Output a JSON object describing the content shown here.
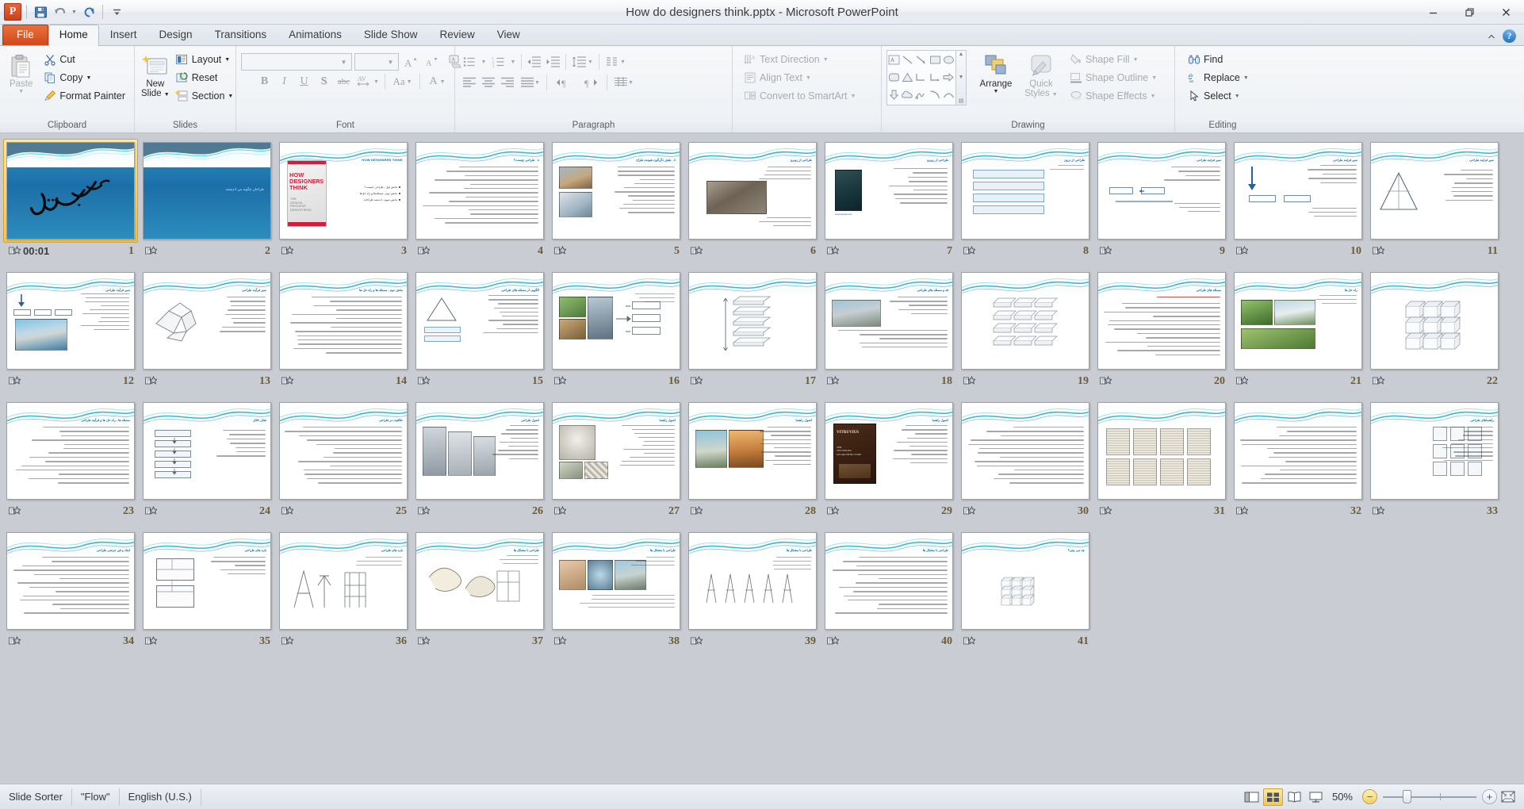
{
  "window": {
    "title": "How do designers think.pptx  -  Microsoft PowerPoint",
    "app_logo": "P",
    "minimize": "—",
    "restore": "❐",
    "close": "✕"
  },
  "quick_access": [
    {
      "name": "save",
      "glyph": "💾"
    },
    {
      "name": "undo",
      "glyph": "↶"
    },
    {
      "name": "undo-dropdown",
      "glyph": "▾"
    },
    {
      "name": "redo",
      "glyph": "↻"
    },
    {
      "name": "customize-qat",
      "glyph": "▾"
    }
  ],
  "tabs": [
    {
      "label": "File",
      "kind": "file"
    },
    {
      "label": "Home",
      "kind": "active"
    },
    {
      "label": "Insert",
      "kind": "normal"
    },
    {
      "label": "Design",
      "kind": "normal"
    },
    {
      "label": "Transitions",
      "kind": "normal"
    },
    {
      "label": "Animations",
      "kind": "normal"
    },
    {
      "label": "Slide Show",
      "kind": "normal"
    },
    {
      "label": "Review",
      "kind": "normal"
    },
    {
      "label": "View",
      "kind": "normal"
    }
  ],
  "tabrow_right": {
    "minimize_ribbon": "⌃",
    "help": "?"
  },
  "ribbon": {
    "groups": [
      {
        "name": "clipboard",
        "label": "Clipboard",
        "has_launcher": true
      },
      {
        "name": "slides",
        "label": "Slides",
        "has_launcher": false
      },
      {
        "name": "font",
        "label": "Font",
        "has_launcher": true
      },
      {
        "name": "paragraph",
        "label": "Paragraph",
        "has_launcher": true
      },
      {
        "name": "drawing",
        "label": "Drawing",
        "has_launcher": true
      },
      {
        "name": "editing",
        "label": "Editing",
        "has_launcher": false
      }
    ],
    "clipboard": {
      "paste": "Paste",
      "cut": "Cut",
      "copy": "Copy",
      "format_painter": "Format Painter"
    },
    "slides": {
      "new_slide": "New\nSlide",
      "new_slide_line1": "New",
      "new_slide_line2": "Slide",
      "layout": "Layout",
      "reset": "Reset",
      "section": "Section"
    },
    "font": {
      "font_name_value": "",
      "font_size_value": "",
      "grow_font": "A",
      "shrink_font": "A",
      "clear_formatting": "Aa",
      "bold": "B",
      "italic": "I",
      "underline": "U",
      "shadow": "S",
      "strikethrough": "abc",
      "character_spacing": "AV",
      "change_case": "Aa",
      "font_color": "A"
    },
    "paragraph": {
      "text_direction": "Text Direction",
      "align_text": "Align Text",
      "convert_to_smartart": "Convert to SmartArt"
    },
    "drawing": {
      "arrange": "Arrange",
      "quick_styles_line1": "Quick",
      "quick_styles_line2": "Styles",
      "shape_fill": "Shape Fill",
      "shape_outline": "Shape Outline",
      "shape_effects": "Shape Effects"
    },
    "editing": {
      "find": "Find",
      "replace": "Replace",
      "select": "Select"
    }
  },
  "status_bar": {
    "view_name": "Slide Sorter",
    "theme_name": "\"Flow\"",
    "language": "English (U.S.)",
    "zoom_level": "50%",
    "zoom_out": "−",
    "zoom_in": "+",
    "views": [
      {
        "name": "normal-view",
        "active": false
      },
      {
        "name": "slide-sorter-view",
        "active": true
      },
      {
        "name": "reading-view",
        "active": false
      },
      {
        "name": "slide-show-view",
        "active": false
      }
    ],
    "fit_to_window": "fit-slide-to-window"
  },
  "slides": {
    "selected_index": 1,
    "timing_label": "00:01",
    "items": [
      {
        "n": "1",
        "style": "dark-bismillah",
        "timing": "00:01",
        "selected": true
      },
      {
        "n": "2",
        "style": "dark-title",
        "title": "طراحان چگونه می اندیشند"
      },
      {
        "n": "3",
        "style": "book-cover",
        "title": "HOW DESIGNERS THINK"
      },
      {
        "n": "4",
        "style": "text-only",
        "title": "1 . طراحی چیست؟"
      },
      {
        "n": "5",
        "style": "two-images-left",
        "title": "2 . نقش دگرگون شونده طراح"
      },
      {
        "n": "6",
        "style": "one-image-center",
        "title": "طراحی از روبرو"
      },
      {
        "n": "7",
        "style": "image-left-narrow",
        "title": "طراحی از روبرو"
      },
      {
        "n": "8",
        "style": "stack-boxes",
        "title": "طراحی از درون"
      },
      {
        "n": "9",
        "style": "diagram-arrows",
        "title": "سیر فرایند طراحی"
      },
      {
        "n": "10",
        "style": "diagram-arrow-down",
        "title": "سیر فرایند طراحی"
      },
      {
        "n": "11",
        "style": "triangle-diagram",
        "title": "سیر فرایند طراحی"
      },
      {
        "n": "12",
        "style": "opera-house",
        "title": "سیر فرآیند طراحی"
      },
      {
        "n": "13",
        "style": "folded-paper",
        "title": "سیر فرآیند طراحی"
      },
      {
        "n": "14",
        "style": "text-only",
        "title": "بخش دوم - مسئله ها و راه حل ها"
      },
      {
        "n": "15",
        "style": "diagram-chart",
        "title": "الگویی از مسئله های طراحی"
      },
      {
        "n": "16",
        "style": "collage-flow",
        "title": ""
      },
      {
        "n": "17",
        "style": "stack-tall",
        "title": ""
      },
      {
        "n": "18",
        "style": "photo-right",
        "title": "قد و مسئله های طراحی"
      },
      {
        "n": "19",
        "style": "stack-boxes3",
        "title": ""
      },
      {
        "n": "20",
        "style": "text-red",
        "title": "مسئله های طراحی"
      },
      {
        "n": "21",
        "style": "lotus-temple",
        "title": "راه حل ها"
      },
      {
        "n": "22",
        "style": "cube-grid",
        "title": ""
      },
      {
        "n": "23",
        "style": "text-only",
        "title": "مسئله ها ، راه حل ها و فرآیند طراحی"
      },
      {
        "n": "24",
        "style": "flow-boxes",
        "title": "تفکر خلاق"
      },
      {
        "n": "25",
        "style": "text-only",
        "title": "خلاقیت در طراحی"
      },
      {
        "n": "26",
        "style": "towers",
        "title": "اصول طراحی"
      },
      {
        "n": "27",
        "style": "cathedral",
        "title": "اصول راهنما"
      },
      {
        "n": "28",
        "style": "city-photos",
        "title": "اصول راهنما"
      },
      {
        "n": "29",
        "style": "vitruvius",
        "title": "اصول راهنما"
      },
      {
        "n": "30",
        "style": "text-only",
        "title": ""
      },
      {
        "n": "31",
        "style": "manuscripts",
        "title": ""
      },
      {
        "n": "32",
        "style": "text-only",
        "title": ""
      },
      {
        "n": "33",
        "style": "plan-grid",
        "title": "راهنماهای طراحی"
      },
      {
        "n": "34",
        "style": "text-only",
        "title": "ابعاد و فن عرضی طراحی"
      },
      {
        "n": "35",
        "style": "floorplans",
        "title": "بازه های طراحی"
      },
      {
        "n": "36",
        "style": "sketch-struct",
        "title": "بازه های طراحی"
      },
      {
        "n": "37",
        "style": "sketches",
        "title": "طراحی با مشکل ها"
      },
      {
        "n": "38",
        "style": "faces-dome",
        "title": "طراحی با مشکل ها"
      },
      {
        "n": "39",
        "style": "small-sketches",
        "title": "طراحی با مشکل ها"
      },
      {
        "n": "40",
        "style": "text-only",
        "title": "طراحی با مشکل ها"
      },
      {
        "n": "41",
        "style": "cube-small",
        "title": "چه می بینی؟"
      }
    ]
  },
  "colors": {
    "accent_orange": "#d0481a",
    "selection_gold": "#f7c54a",
    "slide_bg": "#c9cdd3",
    "title_slide_blue": "#1c6fa8",
    "theme_teal": "#25a3b8"
  }
}
